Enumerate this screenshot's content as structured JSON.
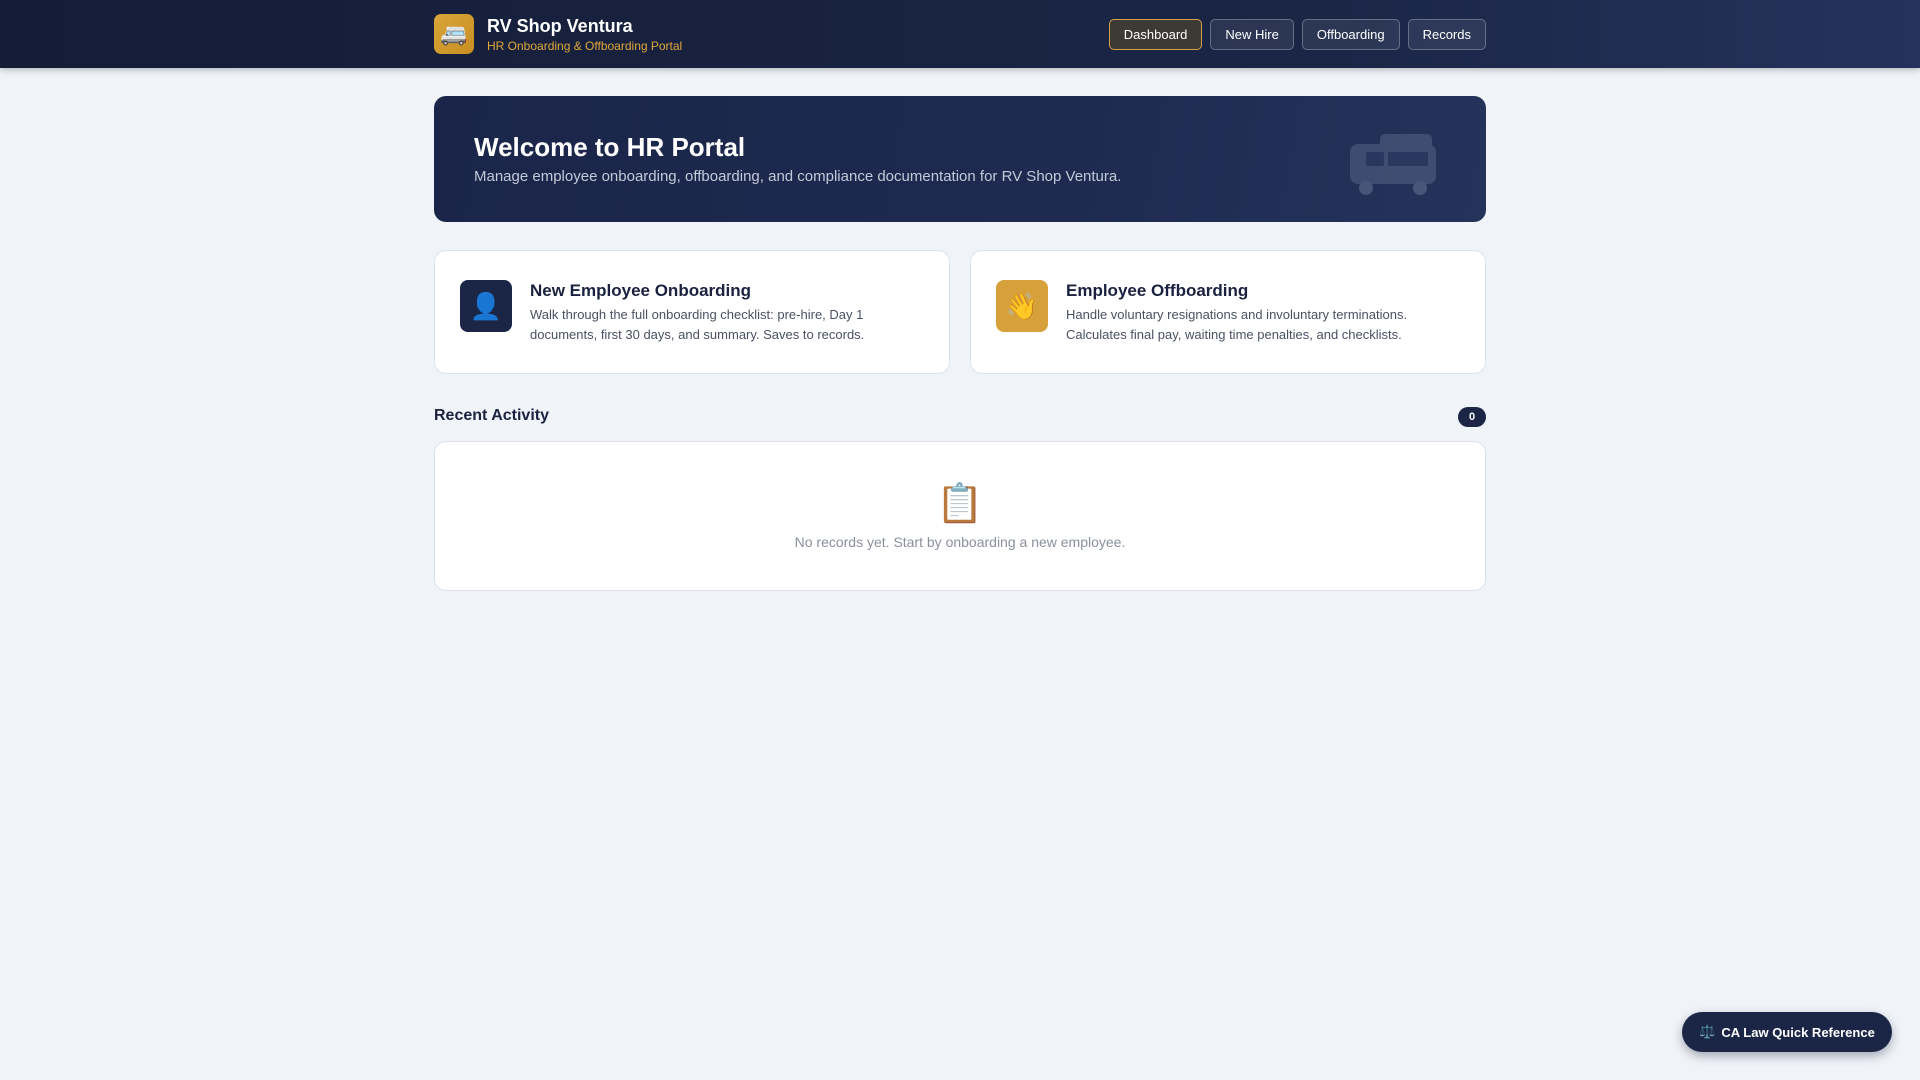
{
  "header": {
    "logo_icon": "rv-bus-icon",
    "logo_glyph": "🚐",
    "title": "RV Shop Ventura",
    "subtitle": "HR Onboarding & Offboarding Portal",
    "nav": [
      {
        "label": "Dashboard",
        "active": true
      },
      {
        "label": "New Hire",
        "active": false
      },
      {
        "label": "Offboarding",
        "active": false
      },
      {
        "label": "Records",
        "active": false
      }
    ]
  },
  "hero": {
    "title": "Welcome to HR Portal",
    "description": "Manage employee onboarding, offboarding, and compliance documentation for RV Shop Ventura.",
    "art_icon": "rv-van-icon"
  },
  "cards": [
    {
      "icon": "person-icon",
      "glyph": "👤",
      "title": "New Employee Onboarding",
      "description": "Walk through the full onboarding checklist: pre-hire, Day 1 documents, first 30 days, and summary. Saves to records."
    },
    {
      "icon": "waving-hand-icon",
      "glyph": "👋",
      "title": "Employee Offboarding",
      "description": "Handle voluntary resignations and involuntary terminations. Calculates final pay, waiting time penalties, and checklists."
    }
  ],
  "recent_activity": {
    "title": "Recent Activity",
    "count": "0",
    "empty_icon": "clipboard-icon",
    "empty_glyph": "📋",
    "empty_text": "No records yet. Start by onboarding a new employee."
  },
  "floating_button": {
    "icon": "scales-icon",
    "glyph": "⚖️",
    "label": "CA Law Quick Reference"
  },
  "colors": {
    "header_bg": "#141d36",
    "accent_gold": "#d6a13a",
    "navy": "#1b2647",
    "page_bg": "#f0f3f8"
  }
}
